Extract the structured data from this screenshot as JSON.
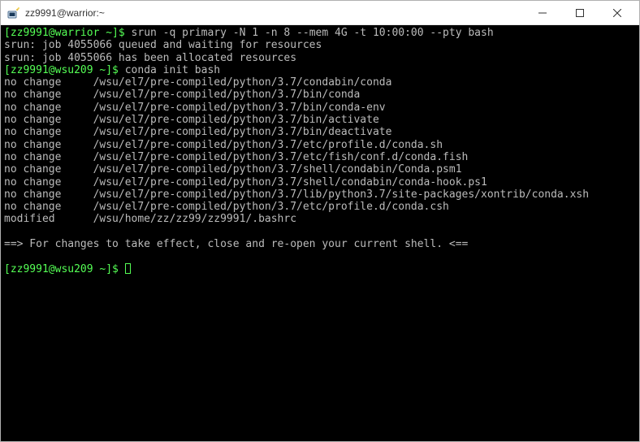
{
  "window": {
    "title": "zz9991@warrior:~"
  },
  "terminal": {
    "prompt1_prefix": "[zz9991@warrior ~]$ ",
    "command1": "srun -q primary -N 1 -n 8 --mem 4G -t 10:00:00 --pty bash",
    "srun_line1": "srun: job 4055066 queued and waiting for resources",
    "srun_line2": "srun: job 4055066 has been allocated resources",
    "prompt2_prefix": "[zz9991@wsu209 ~]$ ",
    "command2": "conda init bash",
    "conda_lines": [
      "no change     /wsu/el7/pre-compiled/python/3.7/condabin/conda",
      "no change     /wsu/el7/pre-compiled/python/3.7/bin/conda",
      "no change     /wsu/el7/pre-compiled/python/3.7/bin/conda-env",
      "no change     /wsu/el7/pre-compiled/python/3.7/bin/activate",
      "no change     /wsu/el7/pre-compiled/python/3.7/bin/deactivate",
      "no change     /wsu/el7/pre-compiled/python/3.7/etc/profile.d/conda.sh",
      "no change     /wsu/el7/pre-compiled/python/3.7/etc/fish/conf.d/conda.fish",
      "no change     /wsu/el7/pre-compiled/python/3.7/shell/condabin/Conda.psm1",
      "no change     /wsu/el7/pre-compiled/python/3.7/shell/condabin/conda-hook.ps1",
      "no change     /wsu/el7/pre-compiled/python/3.7/lib/python3.7/site-packages/xontrib/conda.xsh",
      "no change     /wsu/el7/pre-compiled/python/3.7/etc/profile.d/conda.csh",
      "modified      /wsu/home/zz/zz99/zz9991/.bashrc"
    ],
    "notice_line": "==> For changes to take effect, close and re-open your current shell. <==",
    "prompt3_prefix": "[zz9991@wsu209 ~]$ "
  }
}
